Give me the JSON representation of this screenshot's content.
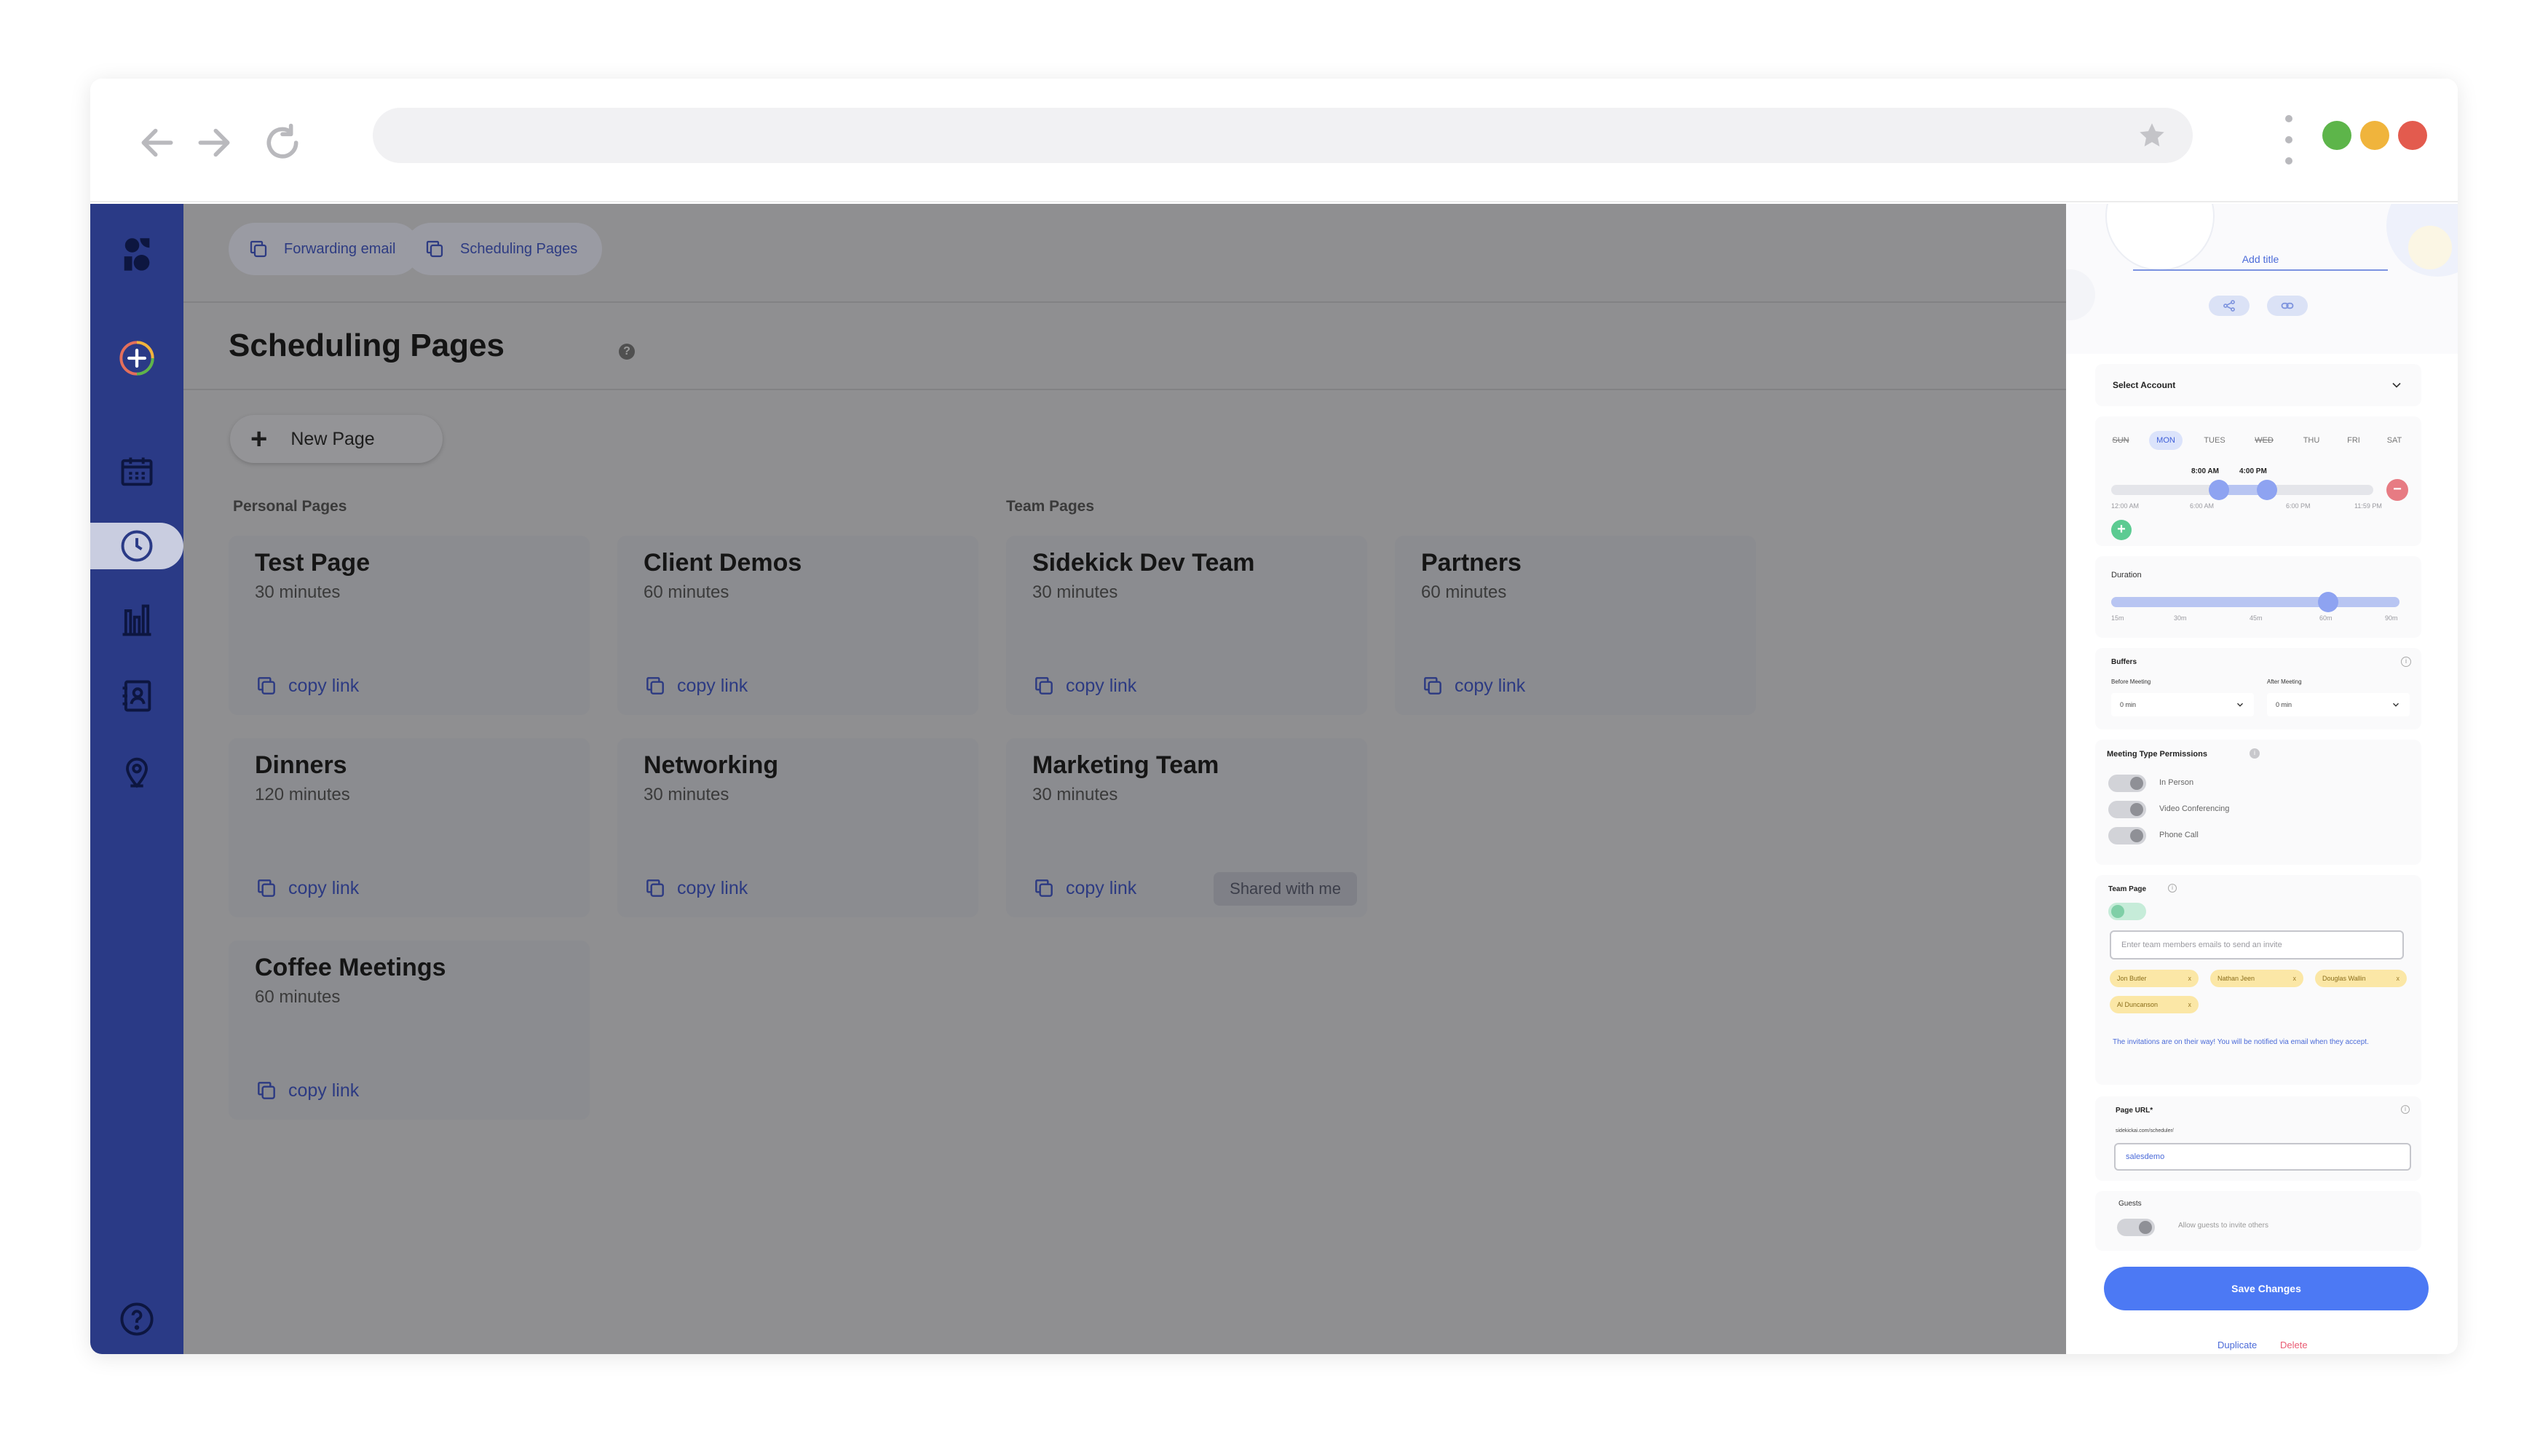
{
  "browser": {
    "back_icon": "arrow-left-icon",
    "forward_icon": "arrow-right-icon",
    "reload_icon": "reload-icon",
    "bookmark_icon": "star-icon",
    "menu_icon": "kebab-menu-icon",
    "traffic_lights": [
      "#5db54a",
      "#f0b43c",
      "#e35b4e"
    ]
  },
  "sidebar": {
    "accent": "#2a3a86",
    "items": [
      {
        "name": "logo",
        "icon": "sidekick-logo-icon"
      },
      {
        "name": "create",
        "icon": "plus-circle-icon"
      },
      {
        "name": "calendar",
        "icon": "calendar-icon"
      },
      {
        "name": "scheduling",
        "icon": "clock-icon"
      },
      {
        "name": "analytics",
        "icon": "bar-chart-icon"
      },
      {
        "name": "contacts",
        "icon": "contacts-book-icon"
      },
      {
        "name": "locations",
        "icon": "location-pin-icon"
      },
      {
        "name": "help",
        "icon": "help-icon"
      }
    ]
  },
  "topchips": {
    "forwarding": "Forwarding email",
    "scheduling": "Scheduling Pages"
  },
  "main": {
    "title": "Scheduling Pages",
    "help": "?",
    "new_page": "New Page",
    "new_page_plus": "+",
    "personal_label": "Personal Pages",
    "team_label": "Team Pages",
    "copy_link": "copy link",
    "shared_label": "Shared with me",
    "cards": [
      {
        "title": "Test Page",
        "duration": "30 minutes"
      },
      {
        "title": "Client Demos",
        "duration": "60 minutes"
      },
      {
        "title": "Sidekick Dev Team",
        "duration": "30 minutes"
      },
      {
        "title": "Partners",
        "duration": "60 minutes"
      },
      {
        "title": "Dinners",
        "duration": "120 minutes"
      },
      {
        "title": "Networking",
        "duration": "30 minutes"
      },
      {
        "title": "Marketing Team",
        "duration": "30 minutes"
      },
      {
        "title": "Coffee Meetings",
        "duration": "60 minutes"
      }
    ]
  },
  "panel": {
    "add_title": "Add title",
    "select_account": "Select Account",
    "days": [
      "SUN",
      "MON",
      "TUES",
      "WED",
      "THU",
      "FRI",
      "SAT"
    ],
    "range_start": "8:00 AM",
    "range_end": "4:00 PM",
    "time_ticks": [
      "12:00 AM",
      "6:00 AM",
      "6:00 PM",
      "11:59 PM"
    ],
    "duration_label": "Duration",
    "duration_ticks": [
      "15m",
      "30m",
      "45m",
      "60m",
      "90m"
    ],
    "duration_value": "60m",
    "buffers_label": "Buffers",
    "before_label": "Before Meeting",
    "after_label": "After Meeting",
    "before_value": "0 min",
    "after_value": "0 min",
    "permissions_label": "Meeting Type Permissions",
    "permissions": [
      "In Person",
      "Video Conferencing",
      "Phone Call"
    ],
    "team_label": "Team Page",
    "invite_placeholder": "Enter team members emails to send an invite",
    "tags": [
      "Jon Butler",
      "Nathan Jeen",
      "Douglas Wallin",
      "Al Duncanson"
    ],
    "tag_remove": "x",
    "invite_note": "The invitations are on their way! You will be notified via email when they accept.",
    "url_label": "Page URL*",
    "url_prefix": "sidekickai.com/scheduler/",
    "url_value": "salesdemo",
    "guests_label": "Guests",
    "guests_option": "Allow guests to invite others",
    "save": "Save Changes",
    "duplicate": "Duplicate",
    "delete": "Delete",
    "accent": "#4c79f4",
    "danger": "#e95b73"
  }
}
